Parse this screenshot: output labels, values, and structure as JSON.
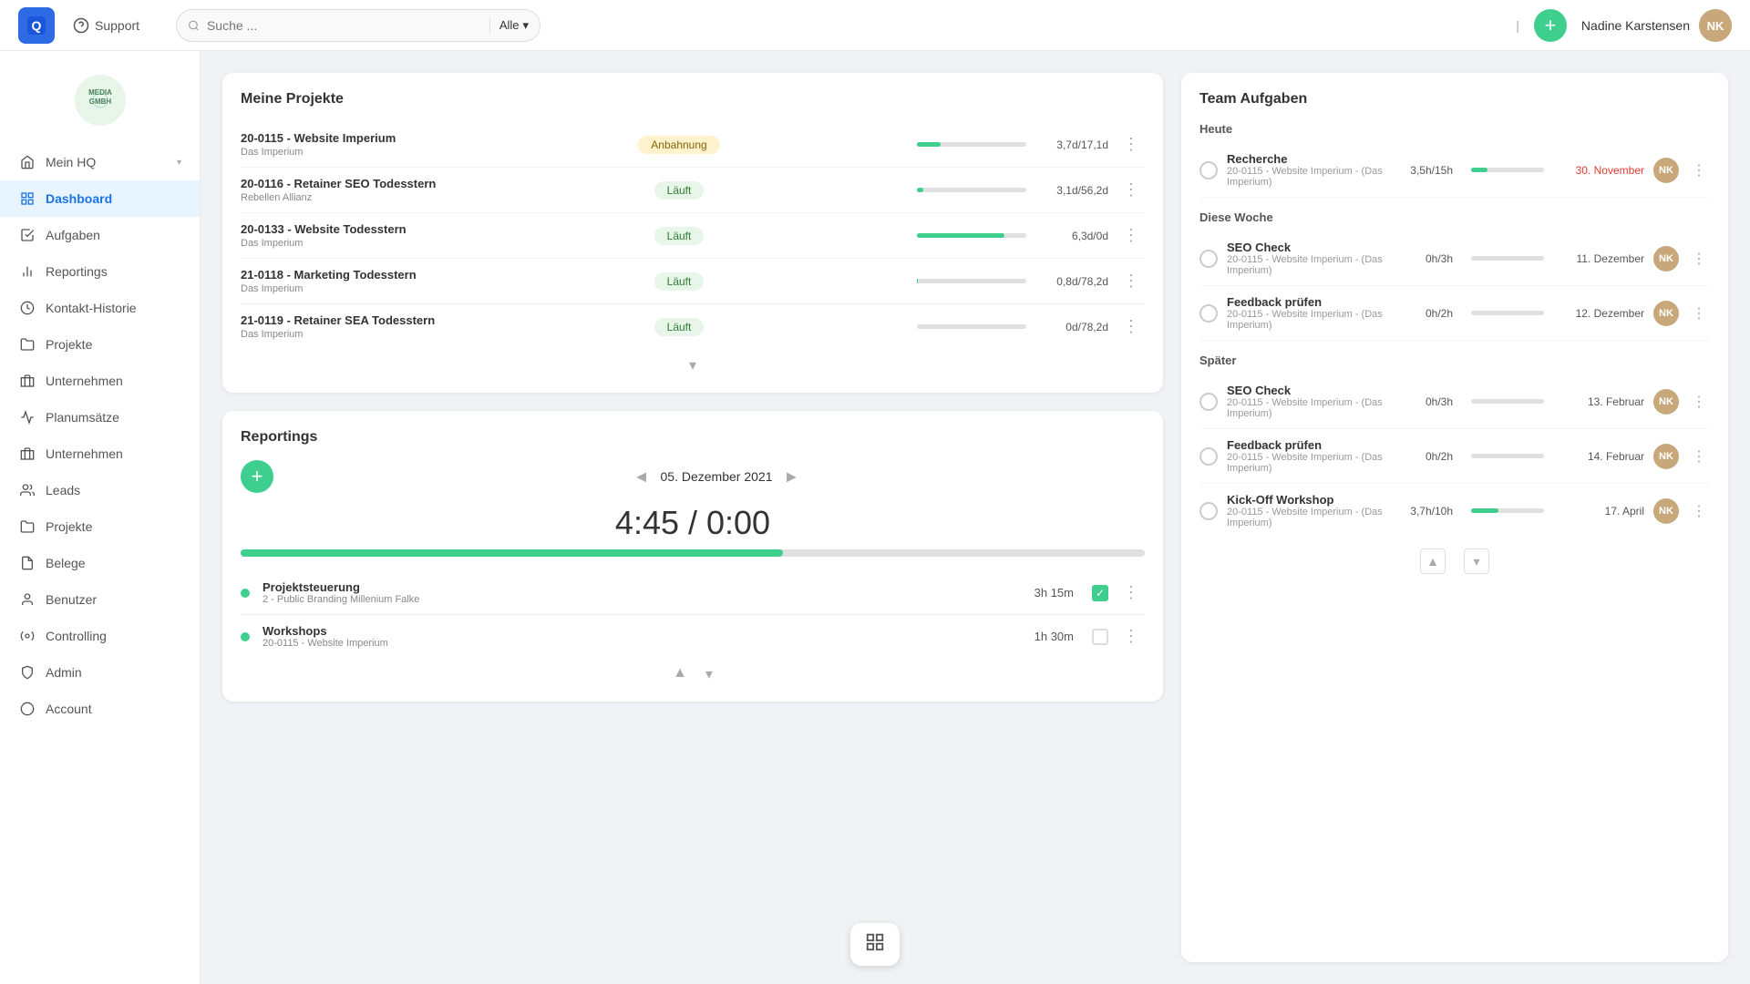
{
  "app": {
    "logo_text": "Q",
    "support_label": "Support",
    "search_placeholder": "Suche ...",
    "search_filter": "Alle",
    "add_btn": "+",
    "user_name": "Nadine Karstensen",
    "user_initials": "NK"
  },
  "sidebar": {
    "company_name": "MEDIA GMBH",
    "items": [
      {
        "id": "mein-hq",
        "label": "Mein HQ",
        "icon": "home",
        "active": false,
        "has_arrow": true
      },
      {
        "id": "dashboard",
        "label": "Dashboard",
        "icon": "dashboard",
        "active": true,
        "has_arrow": false
      },
      {
        "id": "aufgaben",
        "label": "Aufgaben",
        "icon": "tasks",
        "active": false,
        "has_arrow": false
      },
      {
        "id": "reportings",
        "label": "Reportings",
        "icon": "chart",
        "active": false,
        "has_arrow": false
      },
      {
        "id": "kontakt-historie",
        "label": "Kontakt-Historie",
        "icon": "clock",
        "active": false,
        "has_arrow": false
      },
      {
        "id": "projekte1",
        "label": "Projekte",
        "icon": "folder",
        "active": false,
        "has_arrow": false
      },
      {
        "id": "unternehmen1",
        "label": "Unternehmen",
        "icon": "building",
        "active": false,
        "has_arrow": false
      },
      {
        "id": "planums",
        "label": "Planumsätze",
        "icon": "bar",
        "active": false,
        "has_arrow": false
      },
      {
        "id": "unternehmen2",
        "label": "Unternehmen",
        "icon": "building2",
        "active": false,
        "has_arrow": false
      },
      {
        "id": "leads",
        "label": "Leads",
        "icon": "leads",
        "active": false,
        "has_arrow": false
      },
      {
        "id": "projekte2",
        "label": "Projekte",
        "icon": "folder2",
        "active": false,
        "has_arrow": false
      },
      {
        "id": "belege",
        "label": "Belege",
        "icon": "receipt",
        "active": false,
        "has_arrow": false
      },
      {
        "id": "benutzer",
        "label": "Benutzer",
        "icon": "user",
        "active": false,
        "has_arrow": false
      },
      {
        "id": "controlling",
        "label": "Controlling",
        "icon": "controlling",
        "active": false,
        "has_arrow": false
      },
      {
        "id": "admin",
        "label": "Admin",
        "icon": "admin",
        "active": false,
        "has_arrow": false
      },
      {
        "id": "account",
        "label": "Account",
        "icon": "account",
        "active": false,
        "has_arrow": false
      }
    ]
  },
  "meine_projekte": {
    "title": "Meine Projekte",
    "projects": [
      {
        "id": "20-0115",
        "name": "20-0115 - Website Imperium",
        "sub": "Das Imperium",
        "status": "Anbahnung",
        "status_type": "anbahnung",
        "time": "3,7d/17,1d",
        "bar_pct": 22
      },
      {
        "id": "20-0116",
        "name": "20-0116 - Retainer SEO Todesstern",
        "sub": "Rebellen Allianz",
        "status": "Läuft",
        "status_type": "laeuft",
        "time": "3,1d/56,2d",
        "bar_pct": 6
      },
      {
        "id": "20-0133",
        "name": "20-0133 - Website Todesstern",
        "sub": "Das Imperium",
        "status": "Läuft",
        "status_type": "laeuft",
        "time": "6,3d/0d",
        "bar_pct": 80
      },
      {
        "id": "21-0118",
        "name": "21-0118 - Marketing Todesstern",
        "sub": "Das Imperium",
        "status": "Läuft",
        "status_type": "laeuft",
        "time": "0,8d/78,2d",
        "bar_pct": 1
      },
      {
        "id": "21-0119",
        "name": "21-0119 - Retainer SEA Todesstern",
        "sub": "Das Imperium",
        "status": "Läuft",
        "status_type": "laeuft",
        "time": "0d/78,2d",
        "bar_pct": 0
      }
    ]
  },
  "reportings": {
    "title": "Reportings",
    "add_label": "+",
    "date": "05. Dezember 2021",
    "time_display": "4:45 / 0:00",
    "time_slash": " / ",
    "bar_pct": 60,
    "entries": [
      {
        "name": "Projektsteuerung",
        "sub": "2 - Public Branding Millenium Falke",
        "time": "3h 15m",
        "checked": true
      },
      {
        "name": "Workshops",
        "sub": "20-0115 - Website Imperium",
        "time": "1h 30m",
        "checked": false
      }
    ]
  },
  "team_aufgaben": {
    "title": "Team Aufgaben",
    "sections": [
      {
        "label": "Heute",
        "tasks": [
          {
            "name": "Recherche",
            "sub": "20-0115 - Website Imperium - (Das Imperium)",
            "time": "3,5h/15h",
            "progress": 23,
            "date": "30. November",
            "date_color": "red"
          }
        ]
      },
      {
        "label": "Diese Woche",
        "tasks": [
          {
            "name": "SEO Check",
            "sub": "20-0115 - Website Imperium - (Das Imperium)",
            "time": "0h/3h",
            "progress": 0,
            "date": "11. Dezember",
            "date_color": "normal"
          },
          {
            "name": "Feedback prüfen",
            "sub": "20-0115 - Website Imperium - (Das Imperium)",
            "time": "0h/2h",
            "progress": 0,
            "date": "12. Dezember",
            "date_color": "normal"
          }
        ]
      },
      {
        "label": "Später",
        "tasks": [
          {
            "name": "SEO Check",
            "sub": "20-0115 - Website Imperium - (Das Imperium)",
            "time": "0h/3h",
            "progress": 0,
            "date": "13. Februar",
            "date_color": "normal"
          },
          {
            "name": "Feedback prüfen",
            "sub": "20-0115 - Website Imperium - (Das Imperium)",
            "time": "0h/2h",
            "progress": 0,
            "date": "14. Februar",
            "date_color": "normal"
          },
          {
            "name": "Kick-Off Workshop",
            "sub": "20-0115 - Website Imperium - (Das Imperium)",
            "time": "3,7h/10h",
            "progress": 37,
            "date": "17. April",
            "date_color": "normal"
          }
        ]
      }
    ]
  },
  "icons": {
    "search": "🔍",
    "home": "🏠",
    "dashboard": "▦",
    "tasks": "✓",
    "chart": "📊",
    "clock": "🕐",
    "folder": "📁",
    "building": "🏢",
    "bar": "📈",
    "leads": "👥",
    "receipt": "🧾",
    "user": "👤",
    "controlling": "⚙",
    "admin": "🛡",
    "account": "○",
    "chevron_down": "▾",
    "chevron_left": "◄",
    "chevron_right": "►",
    "dots": "⋮",
    "check": "✓"
  }
}
